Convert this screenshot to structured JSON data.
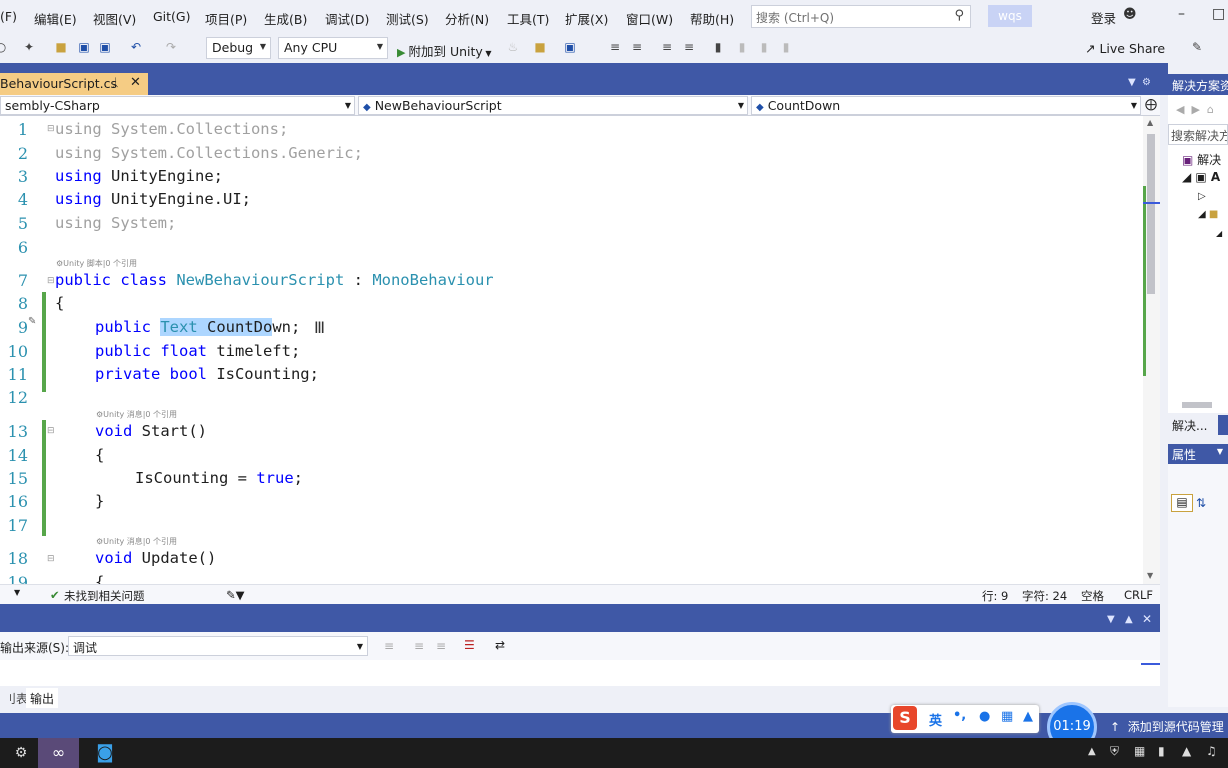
{
  "menu": [
    "(F)",
    "编辑(E)",
    "视图(V)",
    "Git(G)",
    "项目(P)",
    "生成(B)",
    "调试(D)",
    "测试(S)",
    "分析(N)",
    "工具(T)",
    "扩展(X)",
    "窗口(W)",
    "帮助(H)"
  ],
  "search": {
    "placeholder": "搜索 (Ctrl+Q)"
  },
  "user": "wqs",
  "login": "登录",
  "toolbar": {
    "config": "Debug",
    "platform": "Any CPU",
    "attach": "附加到 Unity",
    "liveshare": "Live Share"
  },
  "tab": {
    "title": "BehaviourScript.cs",
    "pin": "ᛣ",
    "close": "✕"
  },
  "nav": {
    "project": "sembly-CSharp",
    "class": "NewBehaviourScript",
    "member": "CountDown"
  },
  "code": {
    "line_numbers": [
      "1",
      "2",
      "3",
      "4",
      "5",
      "6",
      "7",
      "8",
      "9",
      "10",
      "11",
      "12",
      "13",
      "14",
      "15",
      "16",
      "17",
      "18",
      "19"
    ],
    "l1": "using System.Collections;",
    "l2": "using System.Collections.Generic;",
    "l3_kw": "using",
    "l3_rest": " UnityEngine;",
    "l4_kw": "using",
    "l4_rest": " UnityEngine.UI;",
    "l5": "using System;",
    "lens7": "⚙Unity 脚本|0 个引用",
    "l7_kw": "public class ",
    "l7_type": "NewBehaviourScript",
    "l7_sep": " : ",
    "l7_base": "MonoBehaviour",
    "l8": "{",
    "l9_kw": "public ",
    "l9_sel1": "Text",
    "l9_sel2": " CountDo",
    "l9_rest": "wn;",
    "l10_kw": "public float",
    "l10_rest": " timeleft;",
    "l11_kw": "private bool",
    "l11_rest": " IsCounting;",
    "lens13": "⚙Unity 消息|0 个引用",
    "l13_kw": "void",
    "l13_rest": " Start()",
    "l14": "{",
    "l15_a": "IsCounting = ",
    "l15_kw": "true",
    "l15_b": ";",
    "l16": "}",
    "lens18": "⚙Unity 消息|0 个引用",
    "l18_kw": "void",
    "l18_rest": " Update()",
    "l19": "{"
  },
  "status_strip": {
    "issues": "未找到相关问题",
    "row": "行: 9",
    "col": "字符: 24",
    "space": "空格",
    "eol": "CRLF"
  },
  "output": {
    "source_label": "输出来源(S):",
    "source_value": "调试",
    "tabs": [
      "刂表",
      "输出"
    ]
  },
  "solution": {
    "title": "解决方案资",
    "search": "搜索解决方",
    "node1": "解决",
    "node2": "A",
    "tab1": "解决...",
    "props": "属性"
  },
  "ime": {
    "lang": "英"
  },
  "clock": "01:19",
  "source_control": "添加到源代码管理",
  "colors": {
    "accent": "#3f58a6",
    "tab_active": "#f5cc84",
    "keyword": "#0000ff",
    "type": "#2b91af"
  }
}
